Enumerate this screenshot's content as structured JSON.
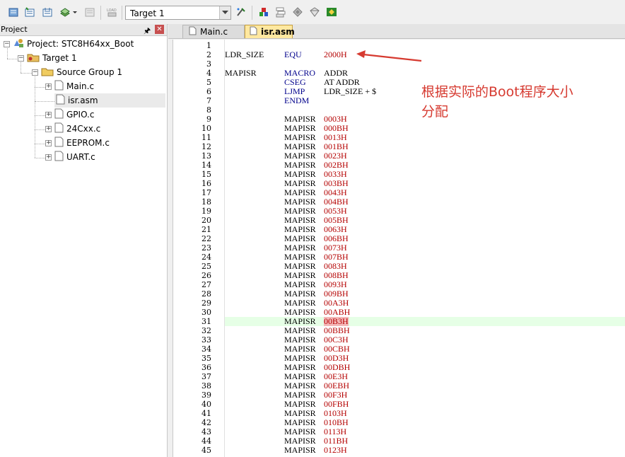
{
  "toolbar": {
    "target_value": "Target 1",
    "icons": [
      "translate-icon",
      "build-icon",
      "rebuild-icon",
      "batch-build-icon",
      "stop-build-icon",
      "download-icon",
      "target-options-icon",
      "manage-components-icon",
      "file-extensions-icon",
      "pack-installer-icon",
      "select-packs-icon",
      "env-icon"
    ]
  },
  "project": {
    "title": "Project",
    "root": "Project: STC8H64xx_Boot",
    "target": "Target 1",
    "group": "Source Group 1",
    "files": [
      "Main.c",
      "isr.asm",
      "GPIO.c",
      "24Cxx.c",
      "EEPROM.c",
      "UART.c"
    ],
    "selected_file": "isr.asm"
  },
  "editor": {
    "tabs": [
      {
        "label": "Main.c",
        "active": false
      },
      {
        "label": "isr.asm",
        "active": true
      }
    ],
    "highlight_line": 31,
    "lines": [
      {
        "n": "1",
        "a": "",
        "b": "",
        "c": ""
      },
      {
        "n": "2",
        "a": "LDR_SIZE",
        "b": "EQU",
        "c": "2000H"
      },
      {
        "n": "3",
        "a": "",
        "b": "",
        "c": ""
      },
      {
        "n": "4",
        "a": "MAPISR",
        "b": "MACRO",
        "c": "ADDR"
      },
      {
        "n": "5",
        "a": "",
        "b": "CSEG",
        "c": "AT  ADDR"
      },
      {
        "n": "6",
        "a": "",
        "b": "LJMP",
        "c": "LDR_SIZE + $"
      },
      {
        "n": "7",
        "a": "",
        "b": "ENDM",
        "c": ""
      },
      {
        "n": "8",
        "a": "",
        "b": "",
        "c": ""
      },
      {
        "n": "9",
        "a": "",
        "b": "MAPISR",
        "c": "0003H"
      },
      {
        "n": "10",
        "a": "",
        "b": "MAPISR",
        "c": "000BH"
      },
      {
        "n": "11",
        "a": "",
        "b": "MAPISR",
        "c": "0013H"
      },
      {
        "n": "12",
        "a": "",
        "b": "MAPISR",
        "c": "001BH"
      },
      {
        "n": "13",
        "a": "",
        "b": "MAPISR",
        "c": "0023H"
      },
      {
        "n": "14",
        "a": "",
        "b": "MAPISR",
        "c": "002BH"
      },
      {
        "n": "15",
        "a": "",
        "b": "MAPISR",
        "c": "0033H"
      },
      {
        "n": "16",
        "a": "",
        "b": "MAPISR",
        "c": "003BH"
      },
      {
        "n": "17",
        "a": "",
        "b": "MAPISR",
        "c": "0043H"
      },
      {
        "n": "18",
        "a": "",
        "b": "MAPISR",
        "c": "004BH"
      },
      {
        "n": "19",
        "a": "",
        "b": "MAPISR",
        "c": "0053H"
      },
      {
        "n": "20",
        "a": "",
        "b": "MAPISR",
        "c": "005BH"
      },
      {
        "n": "21",
        "a": "",
        "b": "MAPISR",
        "c": "0063H"
      },
      {
        "n": "22",
        "a": "",
        "b": "MAPISR",
        "c": "006BH"
      },
      {
        "n": "23",
        "a": "",
        "b": "MAPISR",
        "c": "0073H"
      },
      {
        "n": "24",
        "a": "",
        "b": "MAPISR",
        "c": "007BH"
      },
      {
        "n": "25",
        "a": "",
        "b": "MAPISR",
        "c": "0083H"
      },
      {
        "n": "26",
        "a": "",
        "b": "MAPISR",
        "c": "008BH"
      },
      {
        "n": "27",
        "a": "",
        "b": "MAPISR",
        "c": "0093H"
      },
      {
        "n": "28",
        "a": "",
        "b": "MAPISR",
        "c": "009BH"
      },
      {
        "n": "29",
        "a": "",
        "b": "MAPISR",
        "c": "00A3H"
      },
      {
        "n": "30",
        "a": "",
        "b": "MAPISR",
        "c": "00ABH"
      },
      {
        "n": "31",
        "a": "",
        "b": "MAPISR",
        "c": "00B3H"
      },
      {
        "n": "32",
        "a": "",
        "b": "MAPISR",
        "c": "00BBH"
      },
      {
        "n": "33",
        "a": "",
        "b": "MAPISR",
        "c": "00C3H"
      },
      {
        "n": "34",
        "a": "",
        "b": "MAPISR",
        "c": "00CBH"
      },
      {
        "n": "35",
        "a": "",
        "b": "MAPISR",
        "c": "00D3H"
      },
      {
        "n": "36",
        "a": "",
        "b": "MAPISR",
        "c": "00DBH"
      },
      {
        "n": "37",
        "a": "",
        "b": "MAPISR",
        "c": "00E3H"
      },
      {
        "n": "38",
        "a": "",
        "b": "MAPISR",
        "c": "00EBH"
      },
      {
        "n": "39",
        "a": "",
        "b": "MAPISR",
        "c": "00F3H"
      },
      {
        "n": "40",
        "a": "",
        "b": "MAPISR",
        "c": "00FBH"
      },
      {
        "n": "41",
        "a": "",
        "b": "MAPISR",
        "c": "0103H"
      },
      {
        "n": "42",
        "a": "",
        "b": "MAPISR",
        "c": "010BH"
      },
      {
        "n": "43",
        "a": "",
        "b": "MAPISR",
        "c": "0113H"
      },
      {
        "n": "44",
        "a": "",
        "b": "MAPISR",
        "c": "011BH"
      },
      {
        "n": "45",
        "a": "",
        "b": "MAPISR",
        "c": "0123H"
      }
    ]
  },
  "annotation": {
    "line1": "根据实际的Boot程序大小",
    "line2": "分配",
    "color": "#d63a30"
  }
}
